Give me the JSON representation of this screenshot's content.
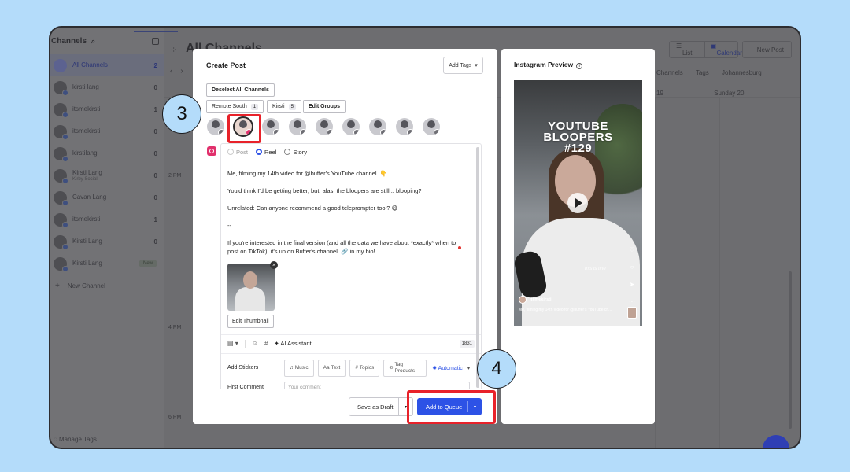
{
  "sidebar": {
    "title": "Channels",
    "items": [
      {
        "name": "All Channels",
        "count": "2",
        "active": true
      },
      {
        "name": "kirsti lang",
        "count": "0"
      },
      {
        "name": "itsmekirsti",
        "count": "1"
      },
      {
        "name": "itsmekirsti",
        "count": "0"
      },
      {
        "name": "kirstilang",
        "count": "0"
      },
      {
        "name": "Kirsti Lang",
        "sub": "Kirby Social",
        "count": "0"
      },
      {
        "name": "Cavan Lang",
        "count": "0"
      },
      {
        "name": "itsmekirsti",
        "count": "1"
      },
      {
        "name": "Kirsti Lang",
        "count": "0"
      },
      {
        "name": "Kirsti Lang",
        "badge": "New"
      }
    ],
    "new_channel": "New Channel",
    "manage_tags": "Manage Tags"
  },
  "calendar": {
    "title": "All Channels",
    "view_list": "List",
    "view_calendar": "Calendar",
    "new_post": "New Post",
    "filters": [
      "Channels",
      "Tags",
      "Johannesburg"
    ],
    "days": [
      "19",
      "Sunday 20"
    ],
    "times": [
      "2 PM",
      "4 PM",
      "6 PM"
    ]
  },
  "modal": {
    "title": "Create Post",
    "add_tags": "Add Tags",
    "deselect_all": "Deselect All Channels",
    "groups": [
      {
        "label": "Remote South",
        "count": "1"
      },
      {
        "label": "Kirsti",
        "count": "5"
      }
    ],
    "edit_groups": "Edit Groups",
    "post_types": [
      "Post",
      "Reel",
      "Story"
    ],
    "caption": [
      "Me, filming my 14th video for @buffer's YouTube channel. 👇",
      "You'd think I'd be getting better, but, alas, the bloopers are still... blooping?",
      "Unrelated: Can anyone recommend a good teleprompter tool? 😅",
      "--",
      "If you're interested in the final version (and all the data we have about *exactly* when to post on TikTok), it's up on Buffer's channel. 🔗 in my bio!"
    ],
    "edit_thumbnail": "Edit Thumbnail",
    "ai_assistant": "AI Assistant",
    "char_count": "1831",
    "add_stickers": "Add Stickers",
    "stickers": [
      "Music",
      "Text",
      "Topics",
      "Tag Products"
    ],
    "automatic": "Automatic",
    "first_comment": "First Comment",
    "comment_placeholder": "Your comment",
    "save_draft": "Save as Draft",
    "add_to_queue": "Add to Queue"
  },
  "preview": {
    "title": "Instagram Preview",
    "headline": [
      "YOUTUBE",
      "BLOOPERS",
      "#129"
    ],
    "overlay_text": "this is fine",
    "username": "itsmekirsti",
    "caption": "Me, filming my 14th video for @buffer's YouTube ch..."
  },
  "annotations": {
    "step3": "3",
    "step4": "4"
  },
  "colors": {
    "accent": "#2d52e6",
    "instagram": "#e1306c",
    "highlight": "#e8222a",
    "backdrop": "#b4dcfa"
  }
}
